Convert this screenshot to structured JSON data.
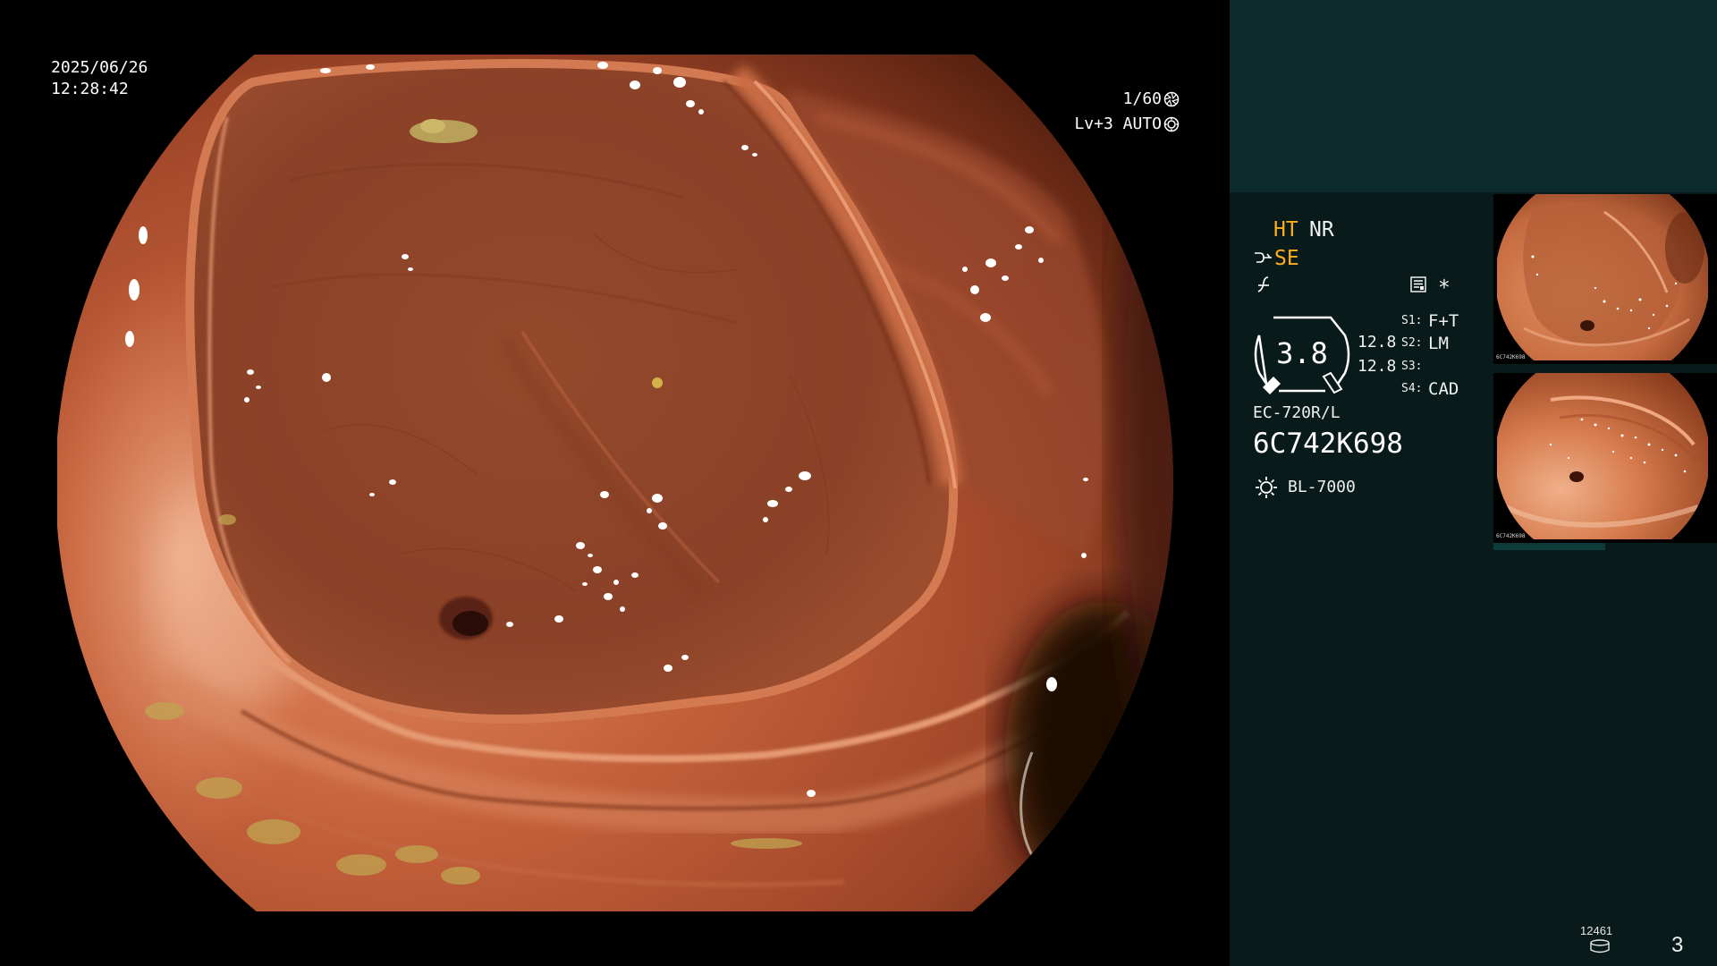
{
  "header": {
    "date": "2025/06/26",
    "time": "12:28:42"
  },
  "exposure": {
    "shutter": "1/60",
    "level_mode": "Lv+3 AUTO"
  },
  "modes": {
    "ht": "HT",
    "nr": "NR",
    "se": "SE",
    "marker": "*"
  },
  "zoom": {
    "value": "3.8",
    "side_values": [
      "12.8",
      "12.8"
    ]
  },
  "switches": [
    {
      "key": "S1:",
      "value": "F+T"
    },
    {
      "key": "S2:",
      "value": "LM"
    },
    {
      "key": "S3:"
    },
    {
      "key": "S4:",
      "value": "CAD"
    }
  ],
  "scope": {
    "model": "EC-720R/L",
    "serial": "6C742K698"
  },
  "light_source": {
    "model": "BL-7000"
  },
  "thumbnails": [
    {
      "serial": "6C742K698"
    },
    {
      "serial": "6C742K698"
    }
  ],
  "storage": {
    "count": "12461",
    "index": "3"
  },
  "colors": {
    "accent": "#ffae1a",
    "panel_top": "#0e2b2b",
    "panel": "#081a19",
    "screen_background": "#000000",
    "text": "#ffffff"
  },
  "icons": [
    "shutter-icon",
    "iris-icon",
    "structure-enhancement-icon",
    "enhancement-mode-icon",
    "document-icon",
    "zoom-gauge-icon",
    "light-source-icon",
    "storage-icon"
  ]
}
